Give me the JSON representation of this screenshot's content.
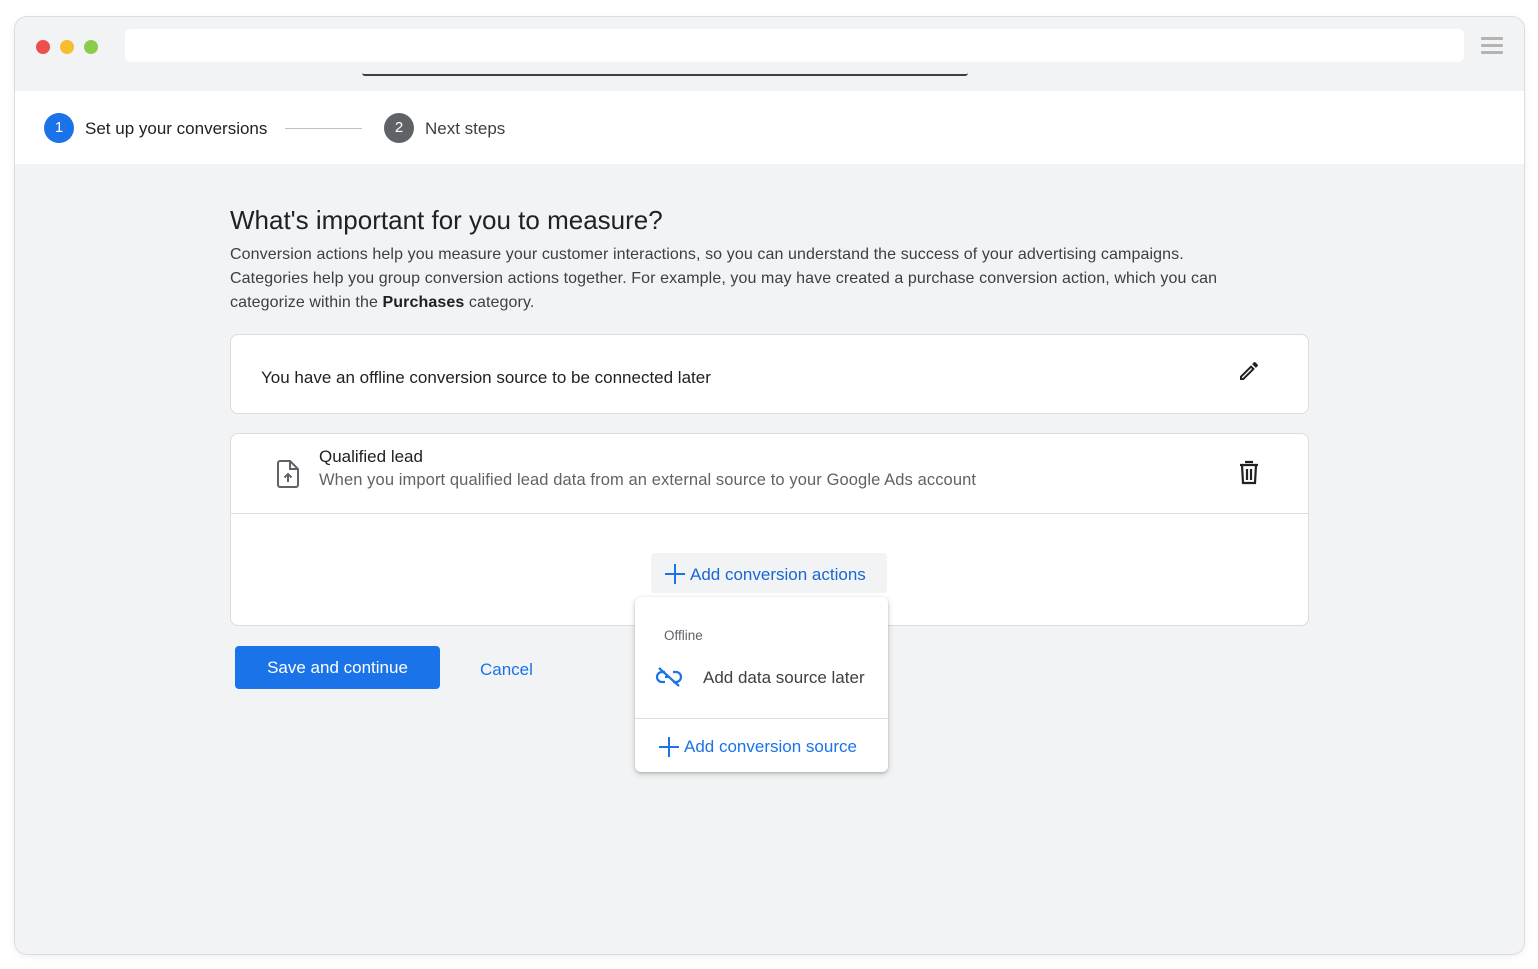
{
  "browser": {
    "url": ""
  },
  "stepper": {
    "steps": [
      {
        "number": "1",
        "label": "Set up your conversions"
      },
      {
        "number": "2",
        "label": "Next steps"
      }
    ]
  },
  "main": {
    "heading": "What's important for you to measure?",
    "description_line1": "Conversion actions help you measure your customer interactions, so you can understand the success of your advertising campaigns.",
    "description_line2": "Categories help you group conversion actions together. For example, you may have created a purchase conversion action, which you can",
    "description_line3_pre": "categorize within the ",
    "description_line3_bold": "Purchases",
    "description_line3_post": " category.",
    "offline_source_text": "You have an offline conversion source to be connected later",
    "action": {
      "title": "Qualified lead",
      "subtitle": "When you import qualified lead data from an external source to your Google Ads account"
    },
    "add_actions_label": "Add conversion actions",
    "save_label": "Save and continue",
    "cancel_label": "Cancel"
  },
  "dropdown": {
    "section": "Offline",
    "item_label": "Add data source later",
    "add_source_label": "Add conversion source"
  },
  "colors": {
    "accent": "#1a73e8",
    "step_inactive": "#5f6368",
    "page_bg": "#f1f3f4"
  },
  "icons": [
    "pencil-icon",
    "file-upload-icon",
    "trash-icon",
    "plus-icon",
    "unlink-icon",
    "menu-icon"
  ]
}
